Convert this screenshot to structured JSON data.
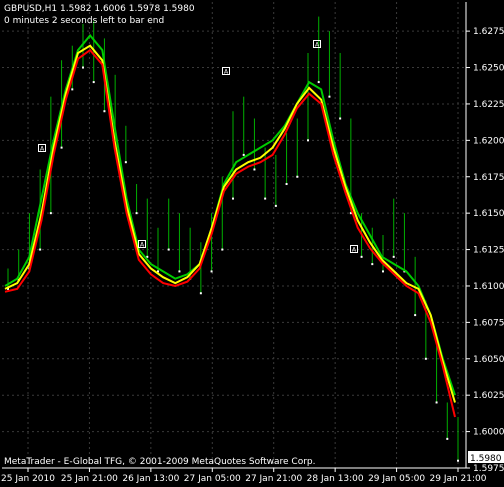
{
  "header": {
    "symbol_line": "GBPUSD,H1  1.5982 1.6006 1.5978 1.5980",
    "timer": "0 minutes 2 seconds left to bar end"
  },
  "footer": {
    "copyright": "MetaTrader - E-Global TFG, © 2001-2009 MetaQuotes Software Corp."
  },
  "current_price": "1.5980",
  "colors": {
    "background": "#000000",
    "grid": "#3a3a3a",
    "bar": "#00b000",
    "fast_ma": "#00cc00",
    "medium_ma": "#ffff00",
    "slow_ma": "#ff0000",
    "markers": "#ffffff"
  },
  "chart_data": {
    "type": "line",
    "timeframe": "H1",
    "y_axis": {
      "ylim": [
        1.5975,
        1.6295
      ],
      "ticks": [
        "1.6275",
        "1.6250",
        "1.6225",
        "1.6200",
        "1.6175",
        "1.6150",
        "1.6125",
        "1.6100",
        "1.6075",
        "1.6050",
        "1.6025",
        "1.6000",
        "1.5975"
      ]
    },
    "x_axis": {
      "ticks": [
        "25 Jan 2010",
        "25 Jan 21:00",
        "26 Jan 13:00",
        "27 Jan 05:00",
        "27 Jan 21:00",
        "28 Jan 13:00",
        "29 Jan 05:00",
        "29 Jan 21:00"
      ]
    },
    "bars": [
      [
        1.6112,
        1.6098
      ],
      [
        1.6125,
        1.6104
      ],
      [
        1.615,
        1.6112
      ],
      [
        1.618,
        1.6125
      ],
      [
        1.623,
        1.615
      ],
      [
        1.6255,
        1.6195
      ],
      [
        1.6265,
        1.6235
      ],
      [
        1.628,
        1.625
      ],
      [
        1.6282,
        1.624
      ],
      [
        1.627,
        1.622
      ],
      [
        1.6245,
        1.6195
      ],
      [
        1.621,
        1.6185
      ],
      [
        1.617,
        1.615
      ],
      [
        1.616,
        1.612
      ],
      [
        1.614,
        1.611
      ],
      [
        1.616,
        1.6125
      ],
      [
        1.615,
        1.611
      ],
      [
        1.614,
        1.6105
      ],
      [
        1.613,
        1.6095
      ],
      [
        1.615,
        1.611
      ],
      [
        1.6175,
        1.6125
      ],
      [
        1.622,
        1.616
      ],
      [
        1.623,
        1.619
      ],
      [
        1.6215,
        1.618
      ],
      [
        1.6195,
        1.616
      ],
      [
        1.619,
        1.6155
      ],
      [
        1.6205,
        1.617
      ],
      [
        1.6215,
        1.6175
      ],
      [
        1.626,
        1.62
      ],
      [
        1.6285,
        1.624
      ],
      [
        1.6275,
        1.623
      ],
      [
        1.626,
        1.6215
      ],
      [
        1.6215,
        1.615
      ],
      [
        1.615,
        1.612
      ],
      [
        1.614,
        1.6115
      ],
      [
        1.6135,
        1.611
      ],
      [
        1.616,
        1.612
      ],
      [
        1.615,
        1.611
      ],
      [
        1.612,
        1.608
      ],
      [
        1.609,
        1.605
      ],
      [
        1.606,
        1.602
      ],
      [
        1.602,
        1.5995
      ],
      [
        1.601,
        1.598
      ]
    ],
    "series": [
      {
        "values": [
          1.61,
          1.6105,
          1.612,
          1.616,
          1.62,
          1.6235,
          1.6262,
          1.6272,
          1.6262,
          1.621,
          1.616,
          1.6125,
          1.6115,
          1.611,
          1.6105,
          1.6108,
          1.6115,
          1.614,
          1.617,
          1.6185,
          1.619,
          1.6195,
          1.62,
          1.621,
          1.6225,
          1.624,
          1.6235,
          1.62,
          1.617,
          1.615,
          1.6135,
          1.612,
          1.6115,
          1.611,
          1.61,
          1.608,
          1.605,
          1.6025
        ]
      },
      {
        "values": [
          1.6098,
          1.6102,
          1.6115,
          1.615,
          1.6195,
          1.6232,
          1.626,
          1.6265,
          1.6255,
          1.62,
          1.6155,
          1.6122,
          1.6112,
          1.6106,
          1.6102,
          1.6106,
          1.6115,
          1.614,
          1.6168,
          1.618,
          1.6185,
          1.6188,
          1.6195,
          1.6208,
          1.6225,
          1.6236,
          1.6228,
          1.6195,
          1.6168,
          1.6145,
          1.613,
          1.6118,
          1.611,
          1.6102,
          1.6098,
          1.608,
          1.6048,
          1.602
        ]
      },
      {
        "values": [
          1.6096,
          1.6098,
          1.611,
          1.6145,
          1.619,
          1.6228,
          1.6256,
          1.6262,
          1.6252,
          1.6195,
          1.615,
          1.6118,
          1.6108,
          1.6102,
          1.61,
          1.6103,
          1.6112,
          1.6136,
          1.6165,
          1.6177,
          1.6182,
          1.6185,
          1.619,
          1.6204,
          1.6222,
          1.6232,
          1.6225,
          1.619,
          1.6164,
          1.614,
          1.6126,
          1.6116,
          1.6108,
          1.61,
          1.6095,
          1.6075,
          1.6045,
          1.601
        ]
      }
    ],
    "markers": [
      "A",
      "A",
      "A",
      "A",
      "A"
    ]
  }
}
